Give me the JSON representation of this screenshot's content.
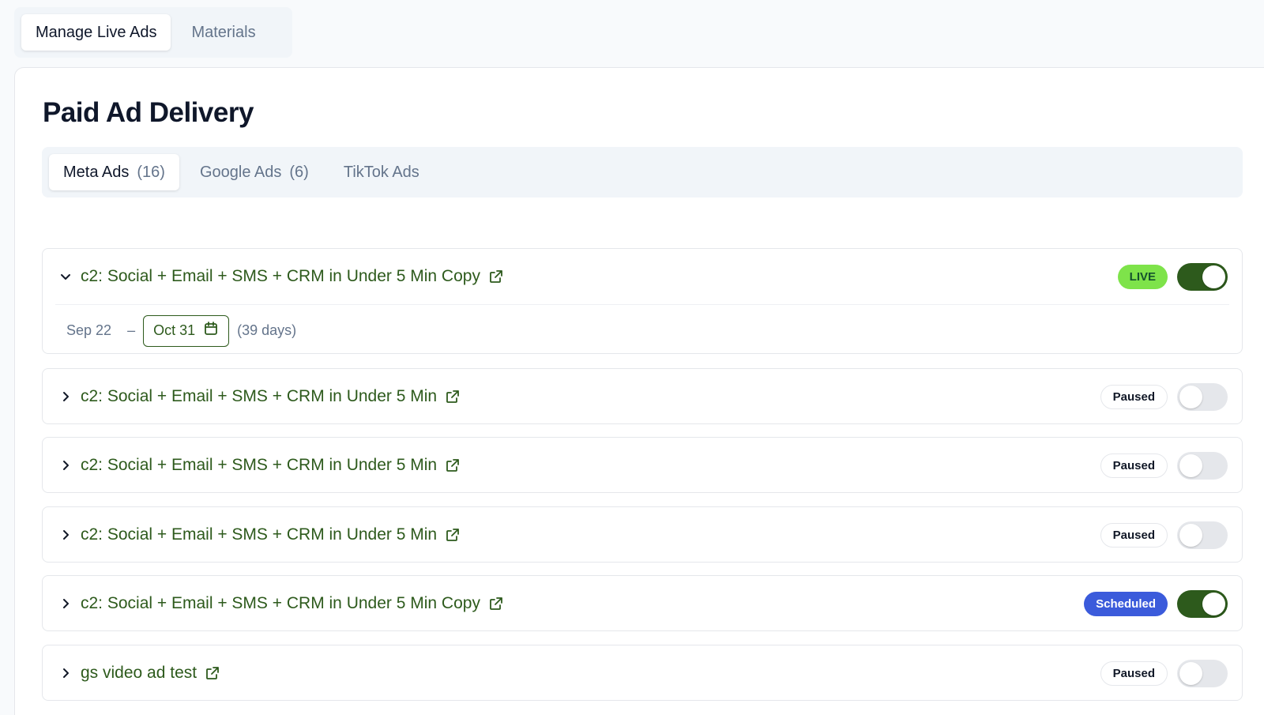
{
  "top_tabs": [
    {
      "label": "Manage Live Ads",
      "active": true
    },
    {
      "label": "Materials",
      "active": false
    }
  ],
  "page_title": "Paid Ad Delivery",
  "sub_tabs": [
    {
      "label": "Meta Ads",
      "count": "(16)",
      "active": true
    },
    {
      "label": "Google Ads",
      "count": "(6)",
      "active": false
    },
    {
      "label": "TikTok Ads",
      "count": "",
      "active": false
    }
  ],
  "ads": [
    {
      "name": "c2: Social + Email + SMS + CRM in Under 5 Min Copy",
      "status": "LIVE",
      "enabled": true,
      "expanded": true,
      "start_date": "Sep 22",
      "separator": "–",
      "end_date": "Oct 31",
      "duration": "(39 days)"
    },
    {
      "name": "c2: Social + Email + SMS + CRM in Under 5 Min",
      "status": "Paused",
      "enabled": false,
      "expanded": false
    },
    {
      "name": "c2: Social + Email + SMS + CRM in Under 5 Min",
      "status": "Paused",
      "enabled": false,
      "expanded": false
    },
    {
      "name": "c2: Social + Email + SMS + CRM in Under 5 Min",
      "status": "Paused",
      "enabled": false,
      "expanded": false
    },
    {
      "name": "c2: Social + Email + SMS + CRM in Under 5 Min Copy",
      "status": "Scheduled",
      "enabled": true,
      "expanded": false
    },
    {
      "name": "gs video ad test",
      "status": "Paused",
      "enabled": false,
      "expanded": false
    }
  ],
  "colors": {
    "brand_green": "#2d5a1c",
    "live_badge": "#7ee34a",
    "scheduled_badge": "#3b5bdb",
    "toggle_off": "#e5e7eb"
  },
  "icons": {
    "expand": "chevron-down-icon",
    "collapse": "chevron-right-icon",
    "external_link": "external-link-icon",
    "calendar": "calendar-icon"
  }
}
